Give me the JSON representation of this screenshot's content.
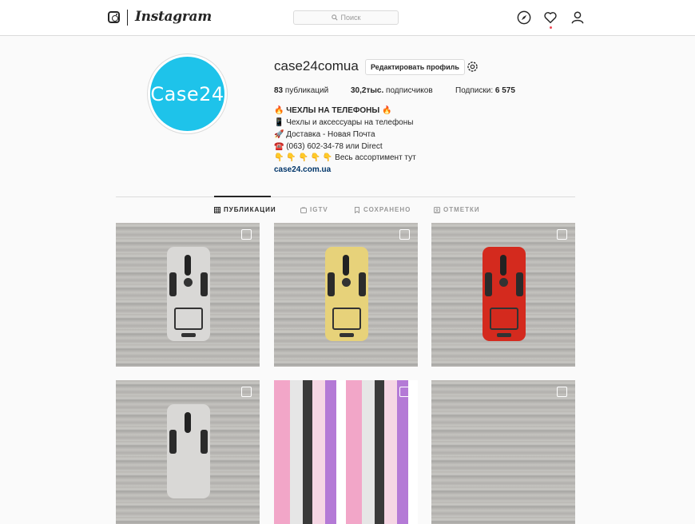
{
  "nav": {
    "brand": "Instagram",
    "search_placeholder": "Поиск",
    "icons": [
      "instagram-glyph-icon",
      "search-icon",
      "compass-icon",
      "heart-icon",
      "user-icon"
    ],
    "accent": "#ed4956"
  },
  "profile": {
    "avatar_text": "Case24",
    "avatar_color": "#1ec3ea",
    "username": "case24comua",
    "edit_button": "Редактировать профиль",
    "stats": {
      "posts_value": "83",
      "posts_label": "публикаций",
      "followers_value": "30,2тыс.",
      "followers_label": "подписчиков",
      "following_label": "Подписки:",
      "following_value": "6 575"
    },
    "bio": {
      "title": "🔥 ЧЕХЛЫ НА ТЕЛЕФОНЫ 🔥",
      "line1": "📱 Чехлы и аксессуары на телефоны",
      "line2": "🚀 Доставка - Новая Почта",
      "line3": "☎️ (063) 602-34-78 или Direct",
      "line4": "👇 👇 👇 👇 👇 Весь ассортимент тут",
      "link": "case24.com.ua"
    }
  },
  "tabs": [
    {
      "label": "ПУБЛИКАЦИИ",
      "icon": "grid-icon",
      "active": true
    },
    {
      "label": "IGTV",
      "icon": "igtv-icon",
      "active": false
    },
    {
      "label": "СОХРАНЕНО",
      "icon": "bookmark-icon",
      "active": false
    },
    {
      "label": "ОТМЕТКИ",
      "icon": "tagged-icon",
      "active": false
    }
  ],
  "posts": [
    {
      "kind": "phone-case",
      "case_color": "#d9d8d6"
    },
    {
      "kind": "phone-case",
      "case_color": "#e7d27a"
    },
    {
      "kind": "phone-case",
      "case_color": "#d42a1e"
    },
    {
      "kind": "phone-case",
      "case_color": "#d9d8d6"
    },
    {
      "kind": "toy-cases"
    },
    {
      "kind": "wood"
    }
  ]
}
